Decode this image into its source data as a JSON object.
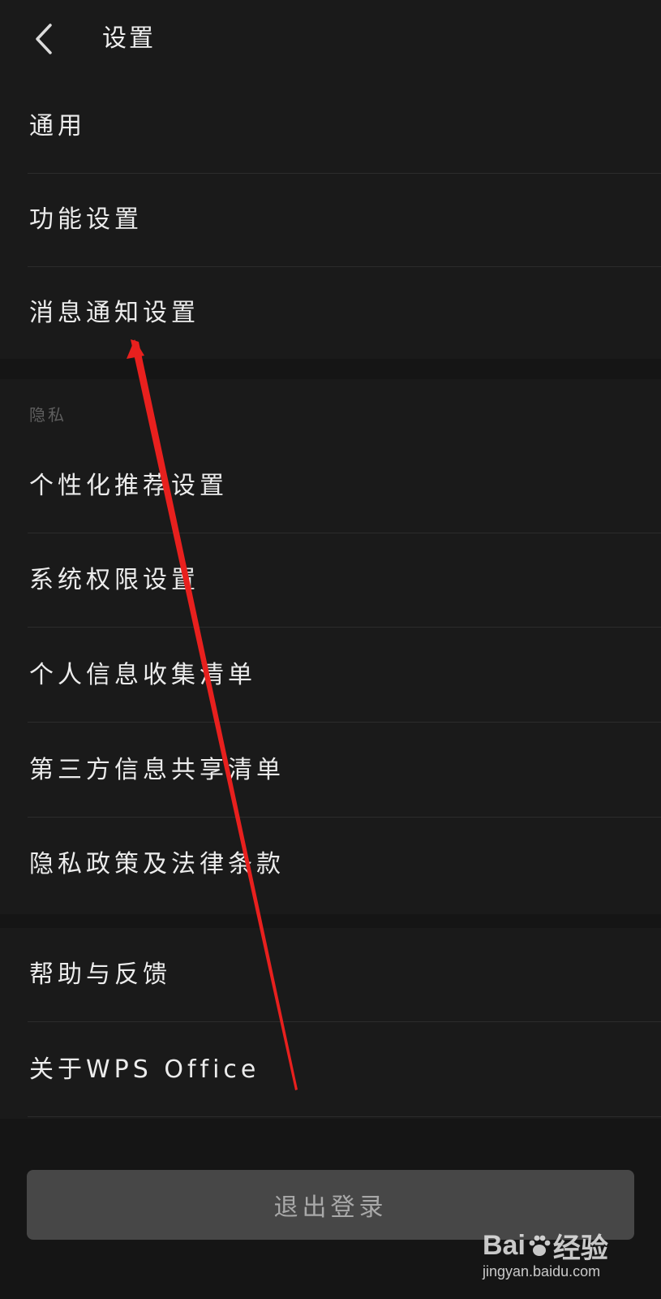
{
  "header": {
    "title": "设置",
    "back_icon": "chevron-left-icon"
  },
  "section_general": {
    "items": [
      {
        "label": "通用"
      },
      {
        "label": "功能设置"
      },
      {
        "label": "消息通知设置"
      }
    ]
  },
  "section_privacy": {
    "title": "隐私",
    "items": [
      {
        "label": "个性化推荐设置"
      },
      {
        "label": "系统权限设置"
      },
      {
        "label": "个人信息收集清单"
      },
      {
        "label": "第三方信息共享清单"
      },
      {
        "label": "隐私政策及法律条款"
      }
    ]
  },
  "section_about": {
    "items": [
      {
        "label": "帮助与反馈"
      },
      {
        "label": "关于WPS Office"
      }
    ]
  },
  "logout": {
    "label": "退出登录"
  },
  "watermark": {
    "brand_left": "Bai",
    "brand_right": "经验",
    "url": "jingyan.baidu.com"
  },
  "colors": {
    "background": "#151515",
    "section": "#1a1a1a",
    "divider": "#2c2c2c",
    "text": "#ececec",
    "muted": "#5e5e5e",
    "button": "#474747",
    "annotation": "#e8201e"
  }
}
